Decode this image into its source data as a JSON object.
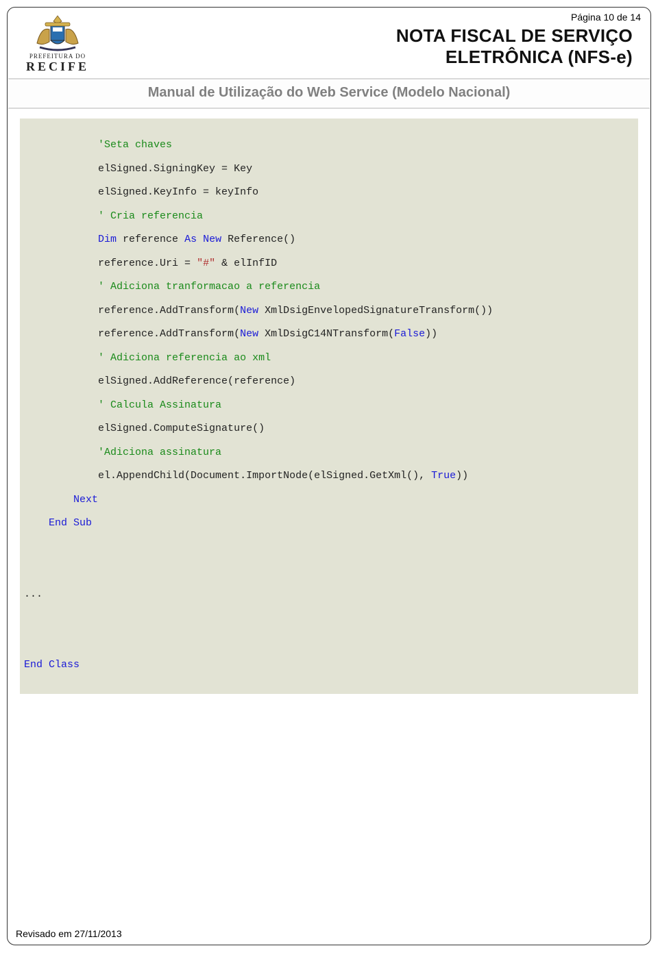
{
  "page_label": "Página 10 de 14",
  "logo": {
    "line1": "PREFEITURA DO",
    "line2": "RECIFE"
  },
  "title": {
    "line1": "NOTA FISCAL DE SERVIÇO",
    "line2": "ELETRÔNICA (NFS-e)"
  },
  "subtitle": "Manual de Utilização do Web Service (Modelo Nacional)",
  "code": {
    "c1": "'Seta chaves",
    "l1": "elSigned.SigningKey = Key",
    "l2": "elSigned.KeyInfo = keyInfo",
    "c2": "' Cria referencia",
    "k_dim": "Dim",
    "l3a": " reference ",
    "k_as": "As",
    "sp1": " ",
    "k_new1": "New",
    "l3b": " Reference()",
    "l4a": "reference.Uri = ",
    "s1": "\"#\"",
    "l4b": " & elInfID",
    "c3": "' Adiciona tranformacao a referencia",
    "l5a": "reference.AddTransform(",
    "k_new2": "New",
    "l5b": " XmlDsigEnvelopedSignatureTransform())",
    "l6a": "reference.AddTransform(",
    "k_new3": "New",
    "l6b": " XmlDsigC14NTransform(",
    "k_false": "False",
    "l6c": "))",
    "c4": "' Adiciona referencia ao xml",
    "l7": "elSigned.AddReference(reference)",
    "c5": "' Calcula Assinatura",
    "l8": "elSigned.ComputeSignature()",
    "c6": "'Adiciona assinatura",
    "l9a": "el.AppendChild(Document.ImportNode(elSigned.GetXml(), ",
    "k_true": "True",
    "l9b": "))",
    "k_next": "Next",
    "k_end": "End",
    "sp2": " ",
    "k_sub": "Sub",
    "dots": "...",
    "k_end2": "End",
    "sp3": " ",
    "k_class": "Class"
  },
  "footer": "Revisado em 27/11/2013"
}
